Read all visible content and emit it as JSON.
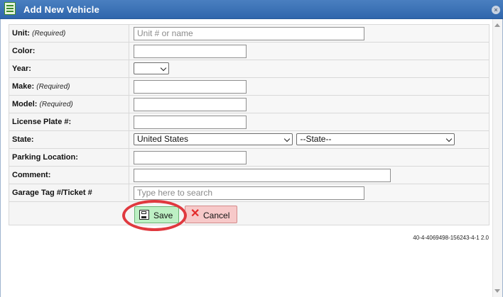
{
  "window": {
    "title": "Add New Vehicle",
    "close_glyph": "×",
    "icon": "form-icon"
  },
  "form": {
    "rows": [
      {
        "label": "Unit:",
        "note": "(Required)",
        "type": "text",
        "placeholder": "Unit # or name",
        "value": ""
      },
      {
        "label": "Color:",
        "note": "",
        "type": "text",
        "placeholder": "",
        "value": ""
      },
      {
        "label": "Year:",
        "note": "",
        "type": "select",
        "value": ""
      },
      {
        "label": "Make:",
        "note": "(Required)",
        "type": "text",
        "placeholder": "",
        "value": ""
      },
      {
        "label": "Model:",
        "note": "(Required)",
        "type": "text",
        "placeholder": "",
        "value": ""
      },
      {
        "label": "License Plate #:",
        "note": "",
        "type": "text",
        "placeholder": "",
        "value": ""
      },
      {
        "label": "State:",
        "note": "",
        "type": "select-pair",
        "country": "United States",
        "state": "--State--"
      },
      {
        "label": "Parking Location:",
        "note": "",
        "type": "text",
        "placeholder": "",
        "value": ""
      },
      {
        "label": "Comment:",
        "note": "",
        "type": "text",
        "placeholder": "",
        "value": ""
      },
      {
        "label": "Garage Tag #/Ticket #",
        "note": "",
        "type": "text",
        "placeholder": "Type here to search",
        "value": ""
      }
    ]
  },
  "actions": {
    "save_label": "Save",
    "cancel_label": "Cancel",
    "save_color": "#bdf0c4",
    "cancel_color": "#f7c9c9",
    "highlight_color": "#e0393f"
  },
  "footer": {
    "version": "40-4-4069498-156243-4-1 2.0"
  }
}
